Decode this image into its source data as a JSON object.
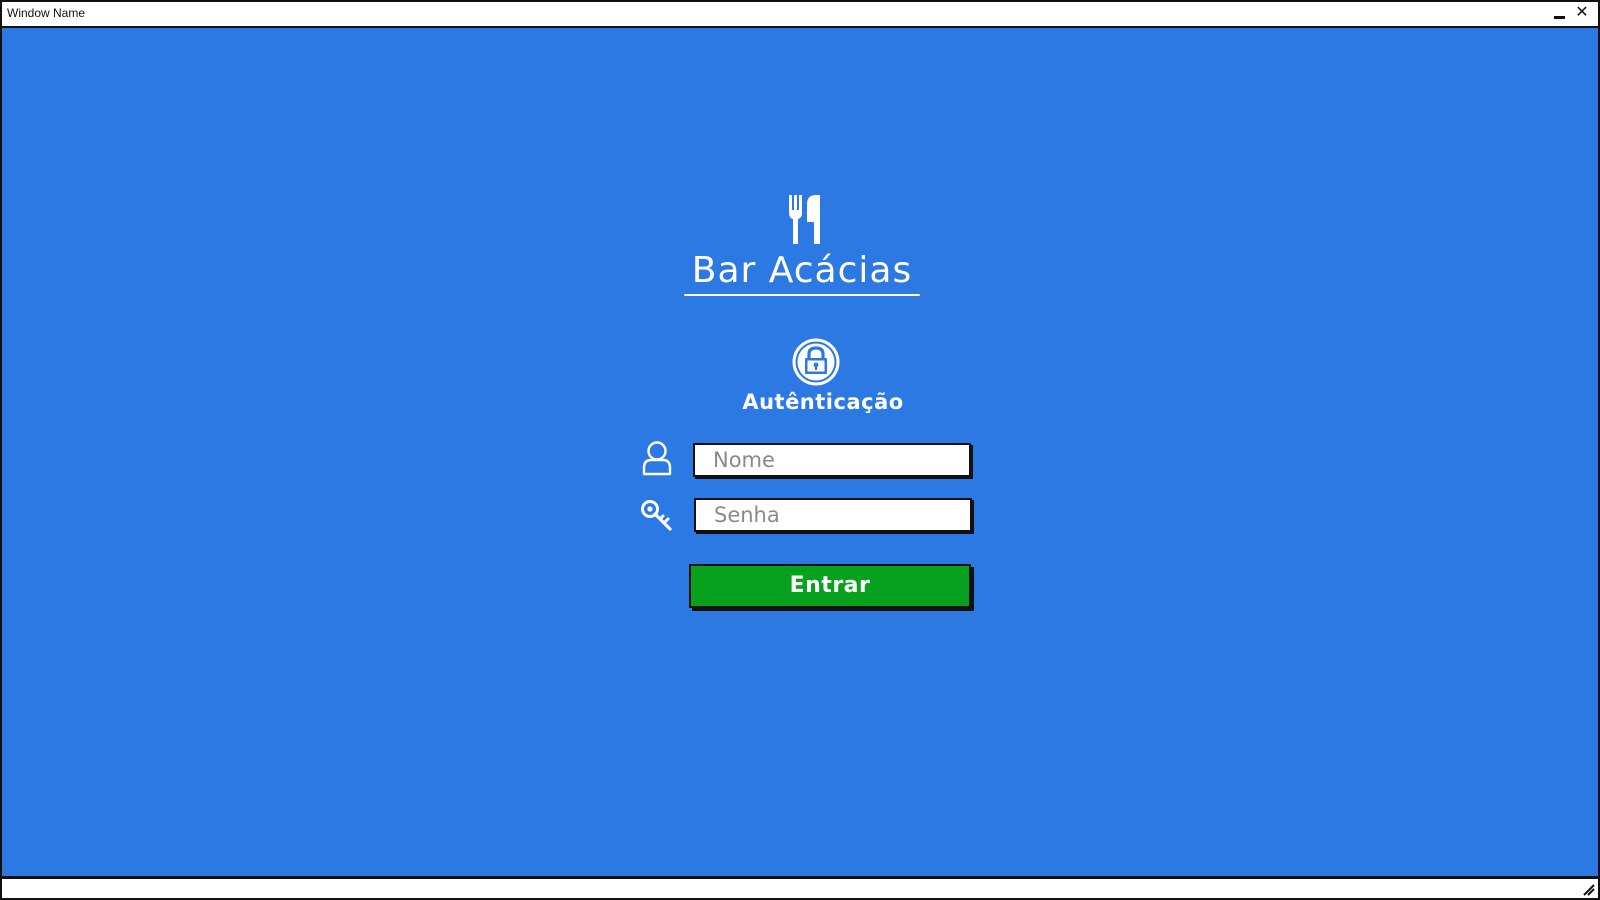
{
  "window": {
    "title": "Window Name",
    "minimize_icon": "minimize-icon",
    "close_icon": "close-icon",
    "close_glyph": "✕"
  },
  "colors": {
    "background": "#2c79e4",
    "button": "#08a11e",
    "text": "#ffffff"
  },
  "logo": {
    "icon": "fork-knife-icon",
    "name": "Bar Acácias"
  },
  "auth": {
    "icon": "lock-icon",
    "label": "Autênticação"
  },
  "form": {
    "name_field": {
      "icon": "user-icon",
      "placeholder": "Nome",
      "value": ""
    },
    "password_field": {
      "icon": "key-icon",
      "placeholder": "Senha",
      "value": ""
    },
    "submit_label": "Entrar"
  },
  "statusbar": {
    "resize_icon": "resize-grip-icon"
  }
}
